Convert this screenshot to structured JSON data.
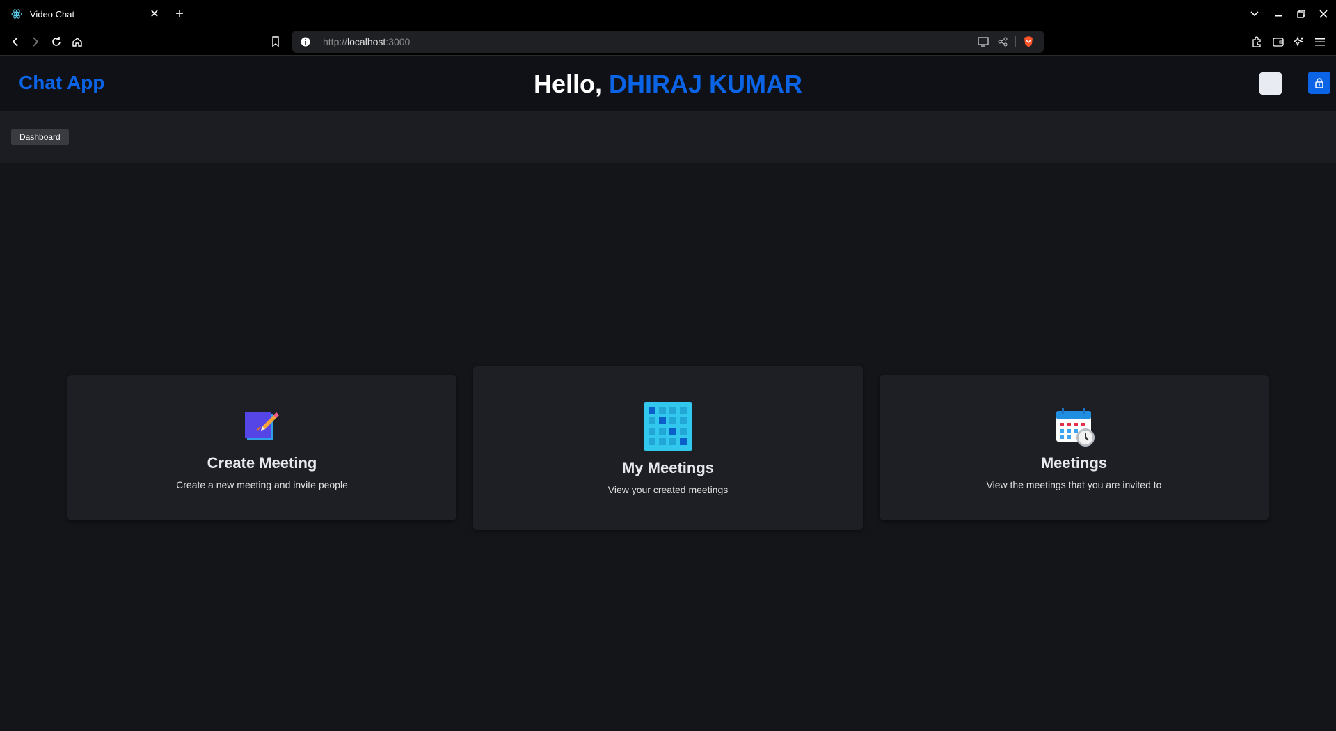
{
  "browser": {
    "tab_title": "Video Chat",
    "url_scheme": "http://",
    "url_host": "localhost",
    "url_port": ":3000"
  },
  "header": {
    "brand": "Chat App",
    "greeting": "Hello,",
    "user_name": "DHIRAJ KUMAR",
    "accent_color": "#0b64e6"
  },
  "breadcrumb": {
    "items": [
      "Dashboard"
    ]
  },
  "cards": [
    {
      "title": "Create Meeting",
      "description": "Create a new meeting and invite people",
      "icon": "create-meeting-icon"
    },
    {
      "title": "My Meetings",
      "description": "View your created meetings",
      "icon": "calendar-grid-icon"
    },
    {
      "title": "Meetings",
      "description": "View the meetings that you are invited to",
      "icon": "calendar-clock-icon"
    }
  ]
}
